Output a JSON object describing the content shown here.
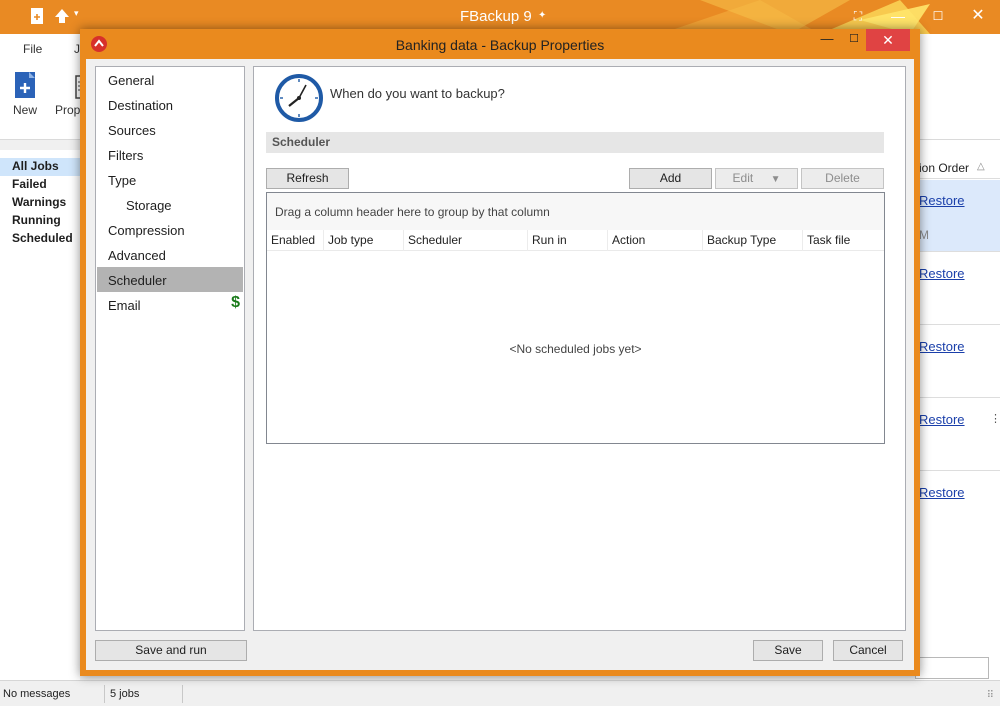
{
  "app": {
    "title": "FBackup 9",
    "tabs": [
      "File",
      "Jo"
    ],
    "ribbon": [
      "New",
      "Prope"
    ],
    "categories": [
      "All Jobs",
      "Failed",
      "Warnings",
      "Running",
      "Scheduled"
    ],
    "right_column_header": "ion Order",
    "restore_label": "Restore",
    "right_partial_text": "M",
    "status": {
      "messages": "No messages",
      "jobs": "5 jobs"
    }
  },
  "dialog": {
    "title": "Banking data - Backup Properties",
    "nav_items": [
      "General",
      "Destination",
      "Sources",
      "Filters",
      "Type",
      "Storage",
      "Compression",
      "Advanced",
      "Scheduler",
      "Email"
    ],
    "selected_nav": "Scheduler",
    "question": "When do you want to backup?",
    "section_title": "Scheduler",
    "buttons": {
      "refresh": "Refresh",
      "add": "Add",
      "edit": "Edit",
      "delete": "Delete",
      "save_and_run": "Save and run",
      "save": "Save",
      "cancel": "Cancel"
    },
    "grid": {
      "group_hint": "Drag a column header here to group by that column",
      "columns": [
        "Enabled",
        "Job type",
        "Scheduler",
        "Run in",
        "Action",
        "Backup Type",
        "Task file"
      ],
      "empty_text": "<No scheduled jobs yet>"
    }
  },
  "colors": {
    "accent": "#ea8a1e",
    "close": "#e04343",
    "selection": "#b3b3b3",
    "link": "#1a3faa"
  }
}
